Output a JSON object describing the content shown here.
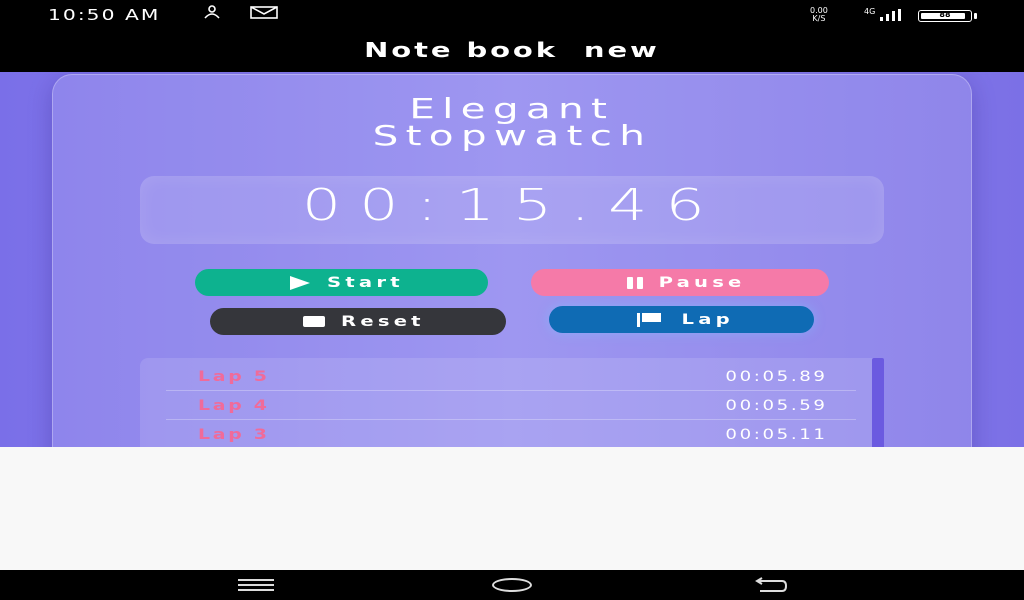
{
  "status": {
    "time": "10:50 AM",
    "icons": [
      "person-icon",
      "mail-icon"
    ],
    "net_speed_value": "0.00",
    "net_speed_unit": "K/S",
    "network_type": "4G",
    "battery": "88"
  },
  "app_bar": {
    "title": "Note book  new"
  },
  "stopwatch": {
    "title_line1": "Elegant",
    "title_line2": "Stopwatch",
    "time": "00:15.46",
    "buttons": {
      "start": "Start",
      "pause": "Pause",
      "reset": "Reset",
      "lap": "Lap"
    },
    "laps": [
      {
        "name": "Lap 5",
        "time": "00:05.89"
      },
      {
        "name": "Lap 4",
        "time": "00:05.59"
      },
      {
        "name": "Lap 3",
        "time": "00:05.11"
      }
    ]
  },
  "colors": {
    "start": "#0db28f",
    "pause": "#f57aa8",
    "reset": "#35363b",
    "lap": "#0f6bb4",
    "lap_name": "#f06b9a",
    "scrollbar": "#6b5ae0"
  },
  "nav": {
    "icons": [
      "menu-icon",
      "home-icon",
      "back-icon"
    ]
  }
}
